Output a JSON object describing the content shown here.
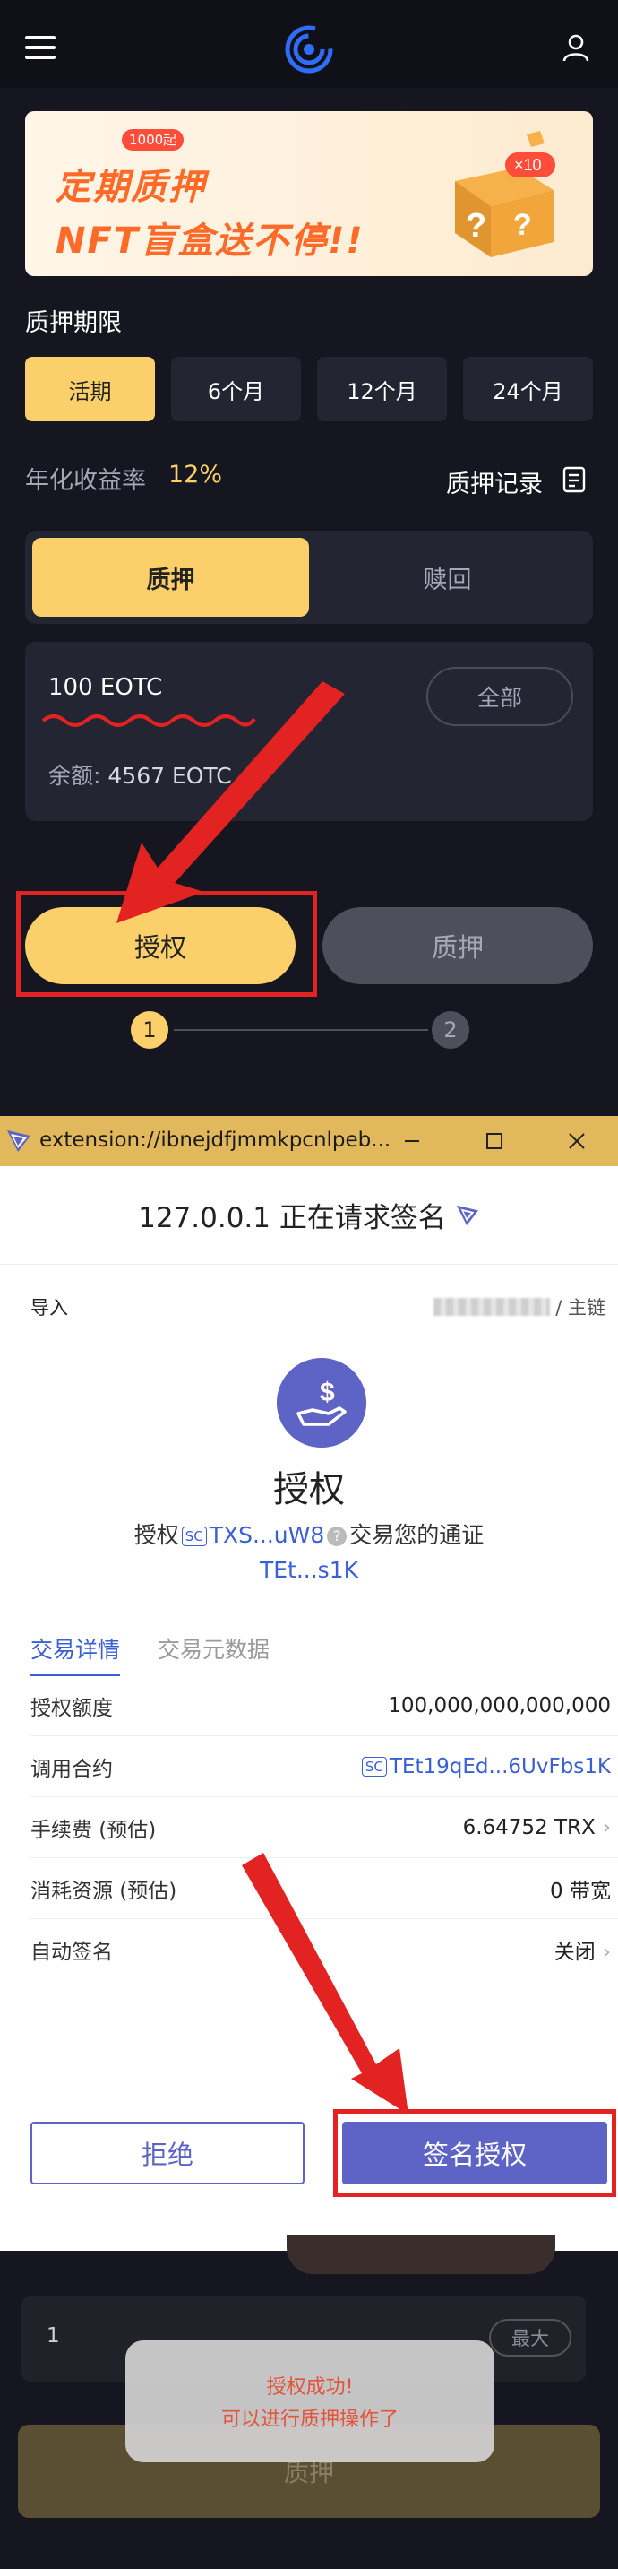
{
  "app": {
    "banner": {
      "badge": "1000起",
      "line1": "定期质押",
      "line2": "NFT盲盒送不停!!",
      "multiplier": "×10"
    },
    "period_title": "质押期限",
    "periods": [
      "活期",
      "6个月",
      "12个月",
      "24个月"
    ],
    "active_period": "活期",
    "rate_label": "年化收益率",
    "rate_value": "12%",
    "record_label": "质押记录",
    "tabs": [
      "质押",
      "赎回"
    ],
    "active_tab": "质押",
    "amount_value": "100 EOTC",
    "all_label": "全部",
    "balance_label": "余额:",
    "balance_value": "4567 EOTC",
    "authorize_button": "授权",
    "stake_button": "质押",
    "steps": [
      "1",
      "2"
    ]
  },
  "popup": {
    "window_title": "extension://ibnejdfjmmkpcnlpeb...",
    "header": "127.0.0.1 正在请求签名",
    "import_label": "导入",
    "network_label": "/ 主链",
    "title": "授权",
    "desc_prefix": "授权",
    "sc_badge": "SC",
    "contract_short": "TXS...uW8",
    "desc_suffix": "交易您的通证",
    "token_short": "TEt...s1K",
    "tabs": [
      "交易详情",
      "交易元数据"
    ],
    "active_tab": "交易详情",
    "rows": [
      {
        "label": "授权额度",
        "value": "100,000,000,000,000"
      },
      {
        "label": "调用合约",
        "value": "TEt19qEd...6UvFbs1K"
      },
      {
        "label": "手续费 (预估)",
        "value": "6.64752 TRX"
      },
      {
        "label": "消耗资源 (预估)",
        "value": "0 带宽"
      },
      {
        "label": "自动签名",
        "value": "关闭"
      }
    ],
    "reject_button": "拒绝",
    "sign_button": "签名授权"
  },
  "background": {
    "amount_value": "1",
    "max_label": "最大",
    "stake_button": "质押",
    "toast_line1": "授权成功!",
    "toast_line2": "可以进行质押操作了"
  },
  "colors": {
    "accent": "#fbd06a",
    "dark_bg": "#15161f",
    "card_bg": "#232532",
    "tron_purple": "#5e63c6",
    "link_blue": "#3a5fd8",
    "annotation_red": "#e32222"
  }
}
